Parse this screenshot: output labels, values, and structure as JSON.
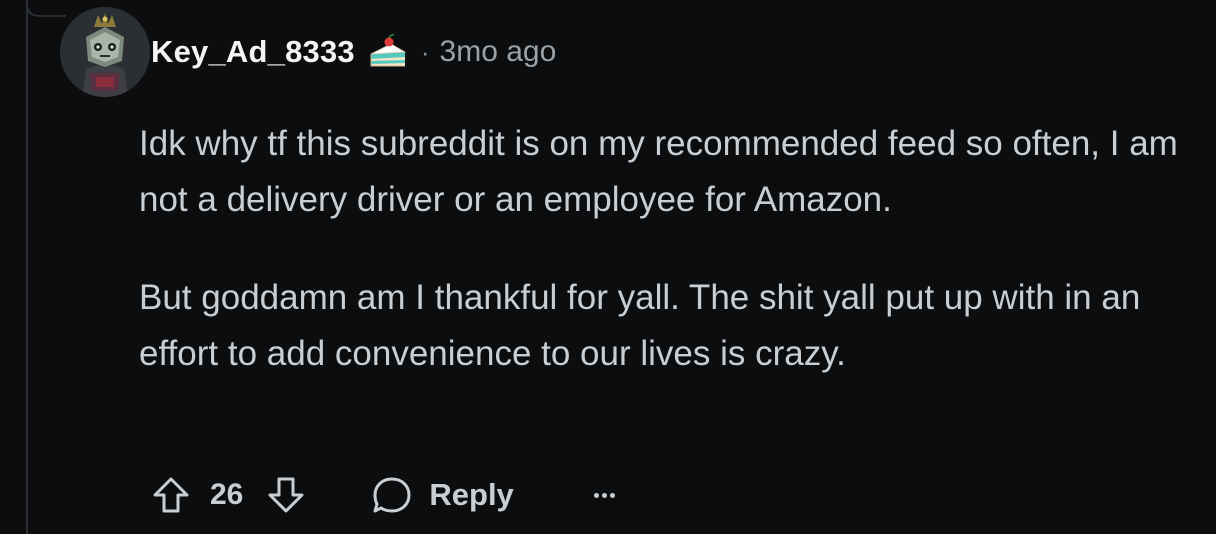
{
  "comment": {
    "author": "Key_Ad_8333",
    "separator": "·",
    "timestamp": "3mo ago",
    "avatar_icon": "robot-knight-avatar",
    "badge_icon": "cake-day-icon",
    "paragraphs": [
      "Idk why tf this subreddit is on my recommended feed so often, I am not a delivery driver or an employee for Amazon.",
      "But goddamn am I thankful for yall. The shit yall put up with in an effort to add convenience to our lives is crazy."
    ]
  },
  "actions": {
    "score": "26",
    "reply_label": "Reply",
    "upvote_icon": "arrow-up-icon",
    "downvote_icon": "arrow-down-icon",
    "reply_icon": "speech-bubble-icon",
    "more_icon": "more-options-icon"
  },
  "colors": {
    "background": "#0b0d0f",
    "text": "#c9ced2",
    "muted": "#9aa1a7"
  }
}
